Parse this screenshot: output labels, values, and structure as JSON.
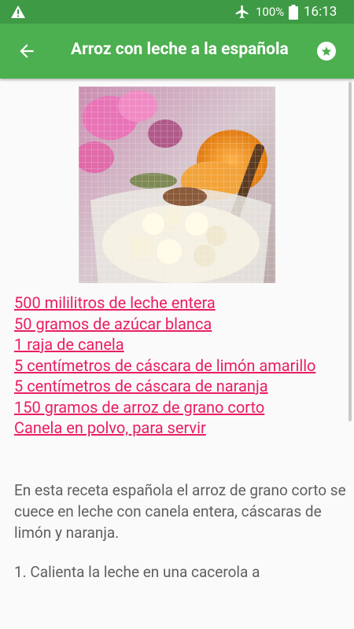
{
  "status_bar": {
    "warning_icon": "warning-icon",
    "airplane_icon": "airplane-mode-icon",
    "battery_percent": "100%",
    "battery_icon": "battery-icon",
    "time": "16:13",
    "color": "#3e9a44"
  },
  "app_bar": {
    "back_icon": "arrow-left-icon",
    "title": "Arroz con leche a la española",
    "favorite_icon": "star-icon",
    "color": "#4caf50"
  },
  "hero_image": {
    "subject": "arroz-con-leche"
  },
  "ingredients": [
    "500 mililitros de leche entera",
    "50 gramos de azúcar blanca",
    "1 raja de canela",
    "5 centímetros de cáscara de limón amarillo",
    "5 centímetros de cáscara de naranja",
    "150 gramos de arroz de grano corto",
    "Canela en polvo, para servir"
  ],
  "link_color": "#e91e63",
  "description": "En esta receta española el arroz de grano corto se cuece en leche con canela entera, cáscaras de limón y naranja.",
  "steps": [
    "1. Calienta la leche en una cacerola a"
  ]
}
